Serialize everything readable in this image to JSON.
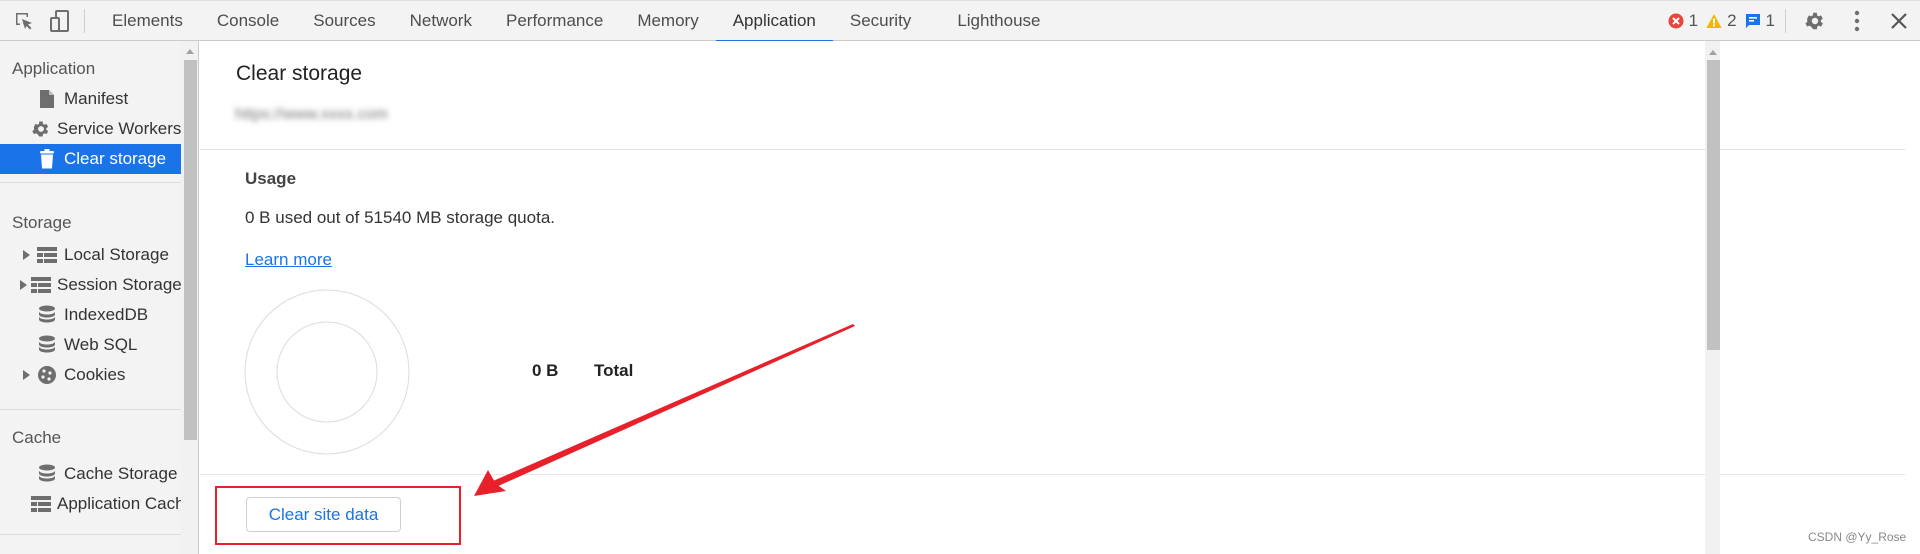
{
  "toolbar": {
    "left_icons": [
      {
        "name": "inspect-element-icon"
      },
      {
        "name": "device-toolbar-icon"
      }
    ],
    "tabs": [
      {
        "label": "Elements",
        "active": false
      },
      {
        "label": "Console",
        "active": false
      },
      {
        "label": "Sources",
        "active": false
      },
      {
        "label": "Network",
        "active": false
      },
      {
        "label": "Performance",
        "active": false
      },
      {
        "label": "Memory",
        "active": false
      },
      {
        "label": "Application",
        "active": true
      },
      {
        "label": "Security",
        "active": false
      },
      {
        "label": "Lighthouse",
        "active": false
      }
    ],
    "counters": {
      "errors": "1",
      "warnings": "2",
      "messages": "1"
    },
    "colors": {
      "error": "#e8453c",
      "warning": "#f4b400",
      "info": "#1a73e8"
    }
  },
  "sidebar": {
    "sections": [
      {
        "title": "Application",
        "items": [
          {
            "label": "Manifest",
            "icon": "document-icon",
            "expandable": false,
            "selected": false
          },
          {
            "label": "Service Workers",
            "icon": "gear-icon",
            "expandable": false,
            "selected": false
          },
          {
            "label": "Clear storage",
            "icon": "trash-icon",
            "expandable": false,
            "selected": true
          }
        ]
      },
      {
        "title": "Storage",
        "items": [
          {
            "label": "Local Storage",
            "icon": "table-icon",
            "expandable": true,
            "selected": false
          },
          {
            "label": "Session Storage",
            "icon": "table-icon",
            "expandable": true,
            "selected": false
          },
          {
            "label": "IndexedDB",
            "icon": "database-icon",
            "expandable": false,
            "selected": false
          },
          {
            "label": "Web SQL",
            "icon": "database-icon",
            "expandable": false,
            "selected": false
          },
          {
            "label": "Cookies",
            "icon": "cookie-icon",
            "expandable": true,
            "selected": false
          }
        ]
      },
      {
        "title": "Cache",
        "items": [
          {
            "label": "Cache Storage",
            "icon": "database-icon",
            "expandable": false,
            "selected": false
          },
          {
            "label": "Application Cache",
            "icon": "table-icon",
            "expandable": false,
            "selected": false
          }
        ]
      }
    ]
  },
  "main": {
    "title": "Clear storage",
    "origin_blurred": "https://www.xxxx.com",
    "usage": {
      "heading": "Usage",
      "summary": "0 B used out of 51540 MB storage quota.",
      "learn_more": "Learn more"
    },
    "chart": {
      "total_value": "0 B",
      "total_label": "Total"
    },
    "clear_button": "Clear site data"
  },
  "chart_data": {
    "type": "pie",
    "title": "",
    "categories": [],
    "values": [],
    "legend": [
      {
        "label": "Total",
        "value": "0 B"
      }
    ],
    "note": "Empty donut chart; no storage used"
  },
  "annotation": {
    "color": "#e8202a"
  },
  "watermark": "CSDN @Yy_Rose"
}
